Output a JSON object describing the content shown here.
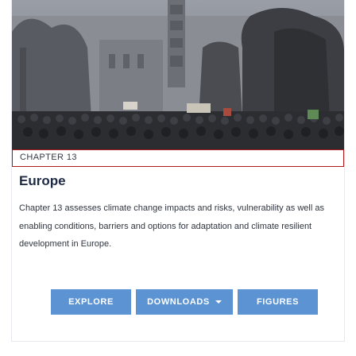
{
  "card": {
    "chapter_label": "CHAPTER 13",
    "title": "Europe",
    "description": "Chapter 13 assesses climate change impacts and risks, vulnerability as well as enabling conditions, barriers and options for adaptation and climate resilient development in Europe.",
    "image_icon": "crowd-photo-icon"
  },
  "buttons": {
    "explore": "EXPLORE",
    "downloads": "DOWNLOADS",
    "figures": "FIGURES",
    "downloads_icon": "caret-down-icon"
  },
  "colors": {
    "accent_border": "#b5181c",
    "button": "#5b93d3",
    "title": "#1e2a44"
  }
}
